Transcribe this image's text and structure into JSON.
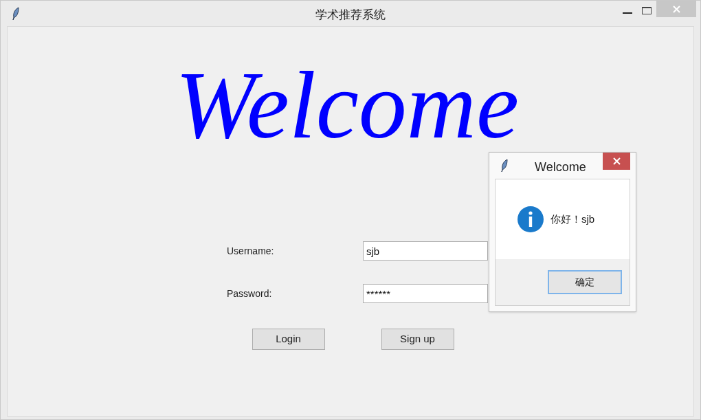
{
  "window": {
    "title": "学术推荐系统"
  },
  "banner": {
    "text": "Welcome"
  },
  "form": {
    "fields": [
      {
        "label": "Username:",
        "value": "sjb"
      },
      {
        "label": "Password:",
        "value": "******"
      }
    ],
    "buttons": [
      "Login",
      "Sign up"
    ]
  },
  "dialog": {
    "title": "Welcome",
    "message": "你好！sjb",
    "button": "确定"
  }
}
